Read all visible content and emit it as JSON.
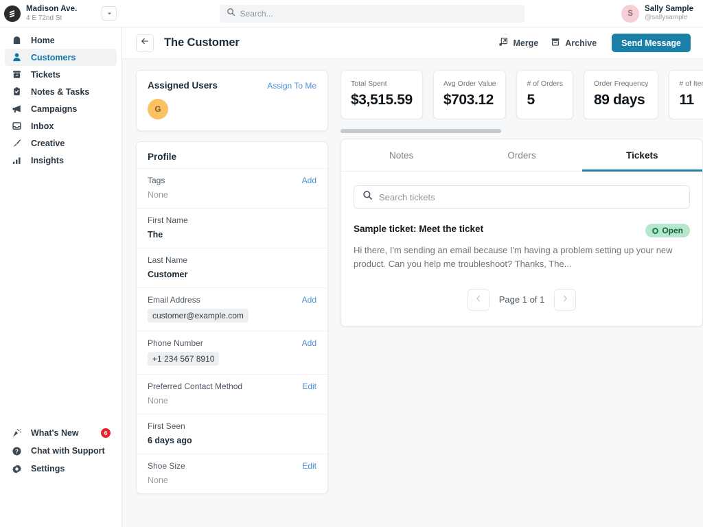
{
  "topbar": {
    "brand": {
      "name": "Madison Ave.",
      "address": "4 E 72nd St",
      "logo_icon": "logo-icon",
      "caret_icon": "chevron-down-icon"
    },
    "search": {
      "placeholder": "Search...",
      "value": "",
      "icon": "search-icon"
    },
    "user": {
      "initial": "S",
      "name": "Sally Sample",
      "handle": "@sallysample"
    }
  },
  "sidebar": {
    "items": [
      {
        "label": "Home",
        "icon": "home-icon",
        "active": false
      },
      {
        "label": "Customers",
        "icon": "person-icon",
        "active": true
      },
      {
        "label": "Tickets",
        "icon": "ticket-icon",
        "active": false
      },
      {
        "label": "Notes & Tasks",
        "icon": "clipboard-check-icon",
        "active": false
      },
      {
        "label": "Campaigns",
        "icon": "megaphone-icon",
        "active": false
      },
      {
        "label": "Inbox",
        "icon": "inbox-icon",
        "active": false
      },
      {
        "label": "Creative",
        "icon": "paintbrush-icon",
        "active": false
      },
      {
        "label": "Insights",
        "icon": "bar-chart-icon",
        "active": false
      }
    ],
    "bottom_items": [
      {
        "label": "What's New",
        "icon": "sparkles-icon",
        "badge": "6"
      },
      {
        "label": "Chat with Support",
        "icon": "question-circle-icon",
        "badge": ""
      },
      {
        "label": "Settings",
        "icon": "gear-icon",
        "badge": ""
      }
    ]
  },
  "page_header": {
    "back_icon": "arrow-left-icon",
    "title": "The Customer",
    "merge_label": "Merge",
    "merge_icon": "merge-icon",
    "archive_label": "Archive",
    "archive_icon": "archive-icon",
    "send_message_label": "Send Message",
    "accent_color": "#1b7fa8"
  },
  "assigned_users": {
    "title": "Assigned Users",
    "action_label": "Assign To Me",
    "avatar_initial": "G",
    "avatar_color": "#fbc264"
  },
  "profile": {
    "title": "Profile",
    "rows": [
      {
        "label": "Tags",
        "action": "Add",
        "value": "None",
        "style": "none"
      },
      {
        "label": "First Name",
        "action": "",
        "value": "The",
        "style": "bold"
      },
      {
        "label": "Last Name",
        "action": "",
        "value": "Customer",
        "style": "bold"
      },
      {
        "label": "Email Address",
        "action": "Add",
        "value": "customer@example.com",
        "style": "chip"
      },
      {
        "label": "Phone Number",
        "action": "Add",
        "value": "+1 234 567 8910",
        "style": "chip"
      },
      {
        "label": "Preferred Contact Method",
        "action": "Edit",
        "value": "None",
        "style": "none"
      },
      {
        "label": "First Seen",
        "action": "",
        "value": "6 days ago",
        "style": "bold"
      },
      {
        "label": "Shoe Size",
        "action": "Edit",
        "value": "None",
        "style": "none"
      }
    ]
  },
  "stats": [
    {
      "label": "Total Spent",
      "value": "$3,515.59"
    },
    {
      "label": "Avg Order Value",
      "value": "$703.12"
    },
    {
      "label": "# of Orders",
      "value": "5"
    },
    {
      "label": "Order Frequency",
      "value": "89 days"
    },
    {
      "label": "# of Items",
      "value": "11"
    }
  ],
  "tabs": [
    {
      "label": "Notes",
      "active": false
    },
    {
      "label": "Orders",
      "active": false
    },
    {
      "label": "Tickets",
      "active": true
    }
  ],
  "tickets_panel": {
    "search": {
      "placeholder": "Search tickets",
      "value": "",
      "icon": "search-icon"
    },
    "tickets": [
      {
        "title": "Sample ticket: Meet the ticket",
        "status": "Open",
        "status_color": "#b6e6cc",
        "excerpt": "Hi there, I'm sending an email because I'm having a problem setting up your new product. Can you help me troubleshoot? Thanks, The..."
      }
    ],
    "pagination": {
      "prev_icon": "chevron-left-icon",
      "text": "Page 1 of 1",
      "next_icon": "chevron-right-icon"
    }
  }
}
